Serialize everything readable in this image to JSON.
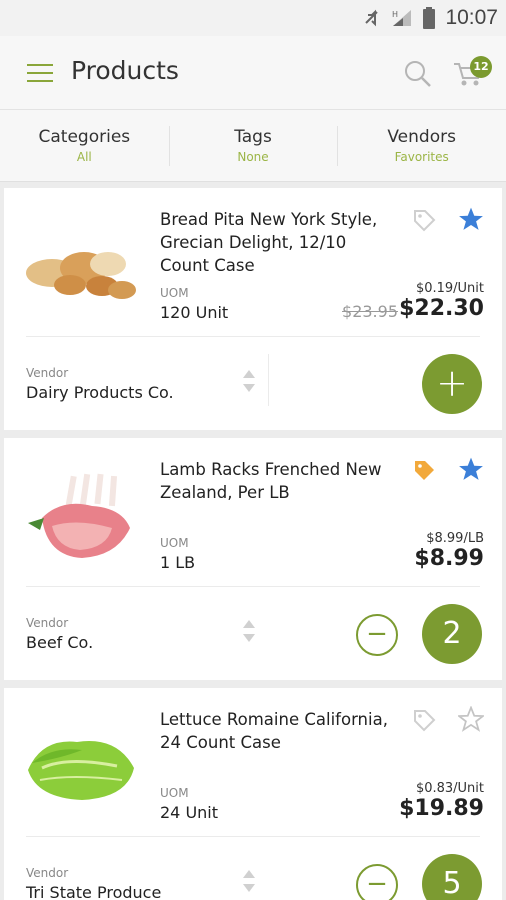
{
  "status_bar": {
    "time": "10:07"
  },
  "header": {
    "title": "Products",
    "cart_count": "12"
  },
  "filters": [
    {
      "label": "Categories",
      "value": "All"
    },
    {
      "label": "Tags",
      "value": "None"
    },
    {
      "label": "Vendors",
      "value": "Favorites"
    }
  ],
  "products": [
    {
      "name": "Bread Pita New York Style, Grecian Delight, 12/10 Count Case",
      "uom_label": "UOM",
      "uom": "120 Unit",
      "unit_price": "$0.19/Unit",
      "old_price": "$23.95",
      "price": "$22.30",
      "vendor_label": "Vendor",
      "vendor": "Dairy Products Co.",
      "action": "+",
      "favorite": true,
      "tagged": false
    },
    {
      "name": "Lamb Racks Frenched New Zealand, Per LB",
      "uom_label": "UOM",
      "uom": "1 LB",
      "unit_price": "$8.99/LB",
      "price": "$8.99",
      "vendor_label": "Vendor",
      "vendor": "Beef Co.",
      "quantity": "2",
      "minus": "−",
      "favorite": true,
      "tagged": true
    },
    {
      "name": "Lettuce Romaine California, 24 Count Case",
      "uom_label": "UOM",
      "uom": "24 Unit",
      "unit_price": "$0.83/Unit",
      "price": "$19.89",
      "vendor_label": "Vendor",
      "vendor": "Tri State Produce",
      "quantity": "5",
      "minus": "−",
      "favorite": false,
      "tagged": false
    }
  ],
  "colors": {
    "accent": "#7c9b31",
    "star": "#3b7fd8",
    "tag_active": "#f2a93b"
  }
}
